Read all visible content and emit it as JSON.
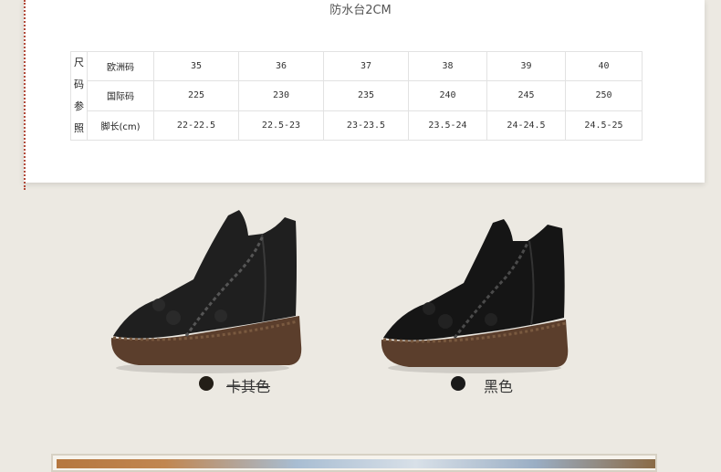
{
  "caption": "防水台2CM",
  "size_table": {
    "side_label": [
      "尺",
      "码",
      "参",
      "照"
    ],
    "rows": [
      {
        "label": "欧洲码",
        "values": [
          "35",
          "36",
          "37",
          "38",
          "39",
          "40"
        ]
      },
      {
        "label": "国际码",
        "values": [
          "225",
          "230",
          "235",
          "240",
          "245",
          "250"
        ]
      },
      {
        "label": "脚长(cm)",
        "values": [
          "22-22.5",
          "22.5-23",
          "23-23.5",
          "23.5-24",
          "24-24.5",
          "24.5-25"
        ]
      }
    ]
  },
  "products": [
    {
      "color_name": "卡其色",
      "swatch": "#231e17"
    },
    {
      "color_name": "黑色",
      "swatch": "#1a1a1a"
    }
  ],
  "colors": {
    "background": "#ece9e2",
    "stitch": "#b14a3a",
    "leather_dark": "#1c1c1c",
    "sole": "#5b3e2c"
  }
}
